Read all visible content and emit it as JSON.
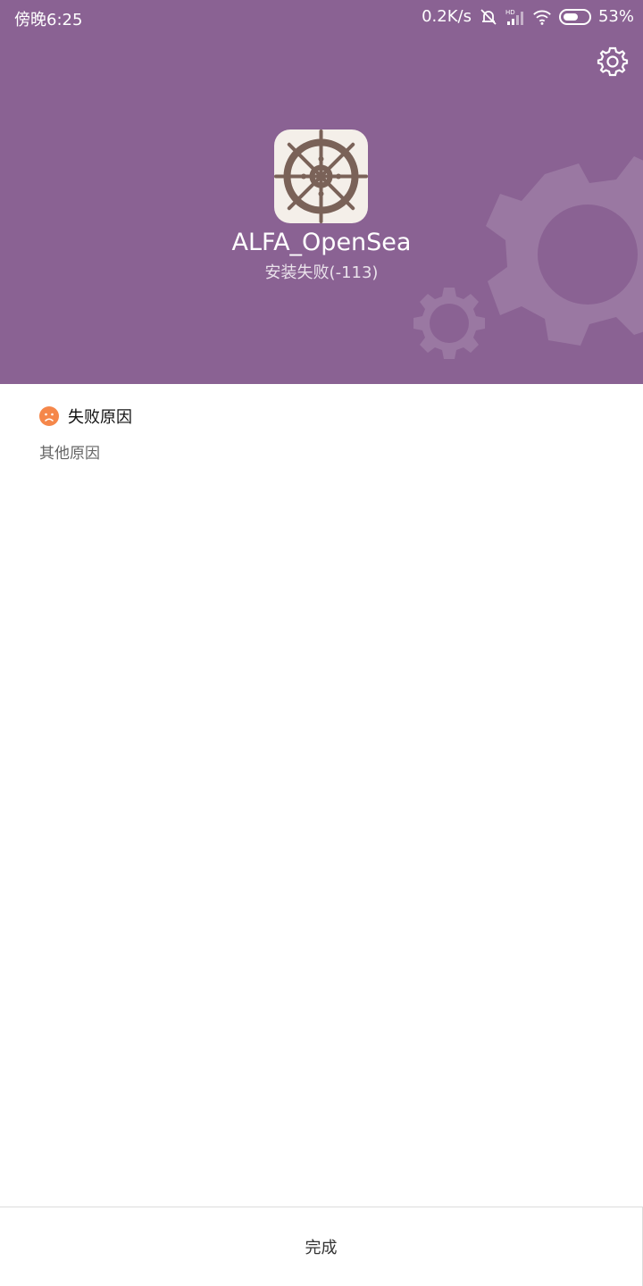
{
  "status_bar": {
    "time": "傍晚6:25",
    "network_speed": "0.2K/s",
    "battery": "53%",
    "icons": [
      "mute-bell-icon",
      "hd-signal-icon",
      "wifi-icon",
      "battery-icon"
    ]
  },
  "header": {
    "background_color": "#8a6293",
    "settings_icon": "gear-icon",
    "decoration_icons": [
      "gear-icon",
      "gear-icon"
    ]
  },
  "app": {
    "icon": "ship-wheel-icon",
    "name": "ALFA_OpenSea",
    "status": "安装失败(-113)"
  },
  "failure": {
    "icon": "sad-face-icon",
    "icon_color": "#f5874a",
    "title": "失败原因",
    "detail": "其他原因"
  },
  "footer": {
    "done_label": "完成"
  }
}
